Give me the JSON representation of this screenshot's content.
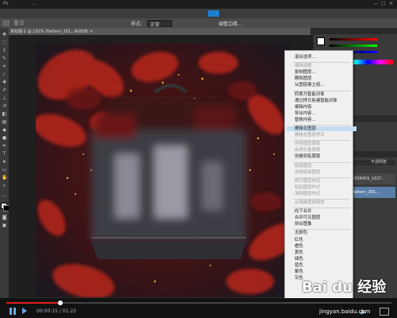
{
  "window": {
    "title": "…",
    "min": "—",
    "max": "□",
    "close": "✕"
  },
  "options_bar": {
    "mode_label": "样式:",
    "mode_value": "正常",
    "adjust": "调整边缘..."
  },
  "document_tab": {
    "label": "未标题-1 @ 102% (Pattern_201...RGB/8) ×"
  },
  "layers_panel": {
    "search_placeholder": "不透明度",
    "layer1": "5358459_1637...",
    "layer2": "Pattern_201...",
    "opacity_label": "不透明度:",
    "fill_label": "填充:"
  },
  "context_menu": {
    "items": [
      {
        "label": "混合选项...",
        "disabled": false
      },
      {
        "label": "编辑调整...",
        "disabled": true
      },
      {
        "label": "复制图层...",
        "disabled": false
      },
      {
        "label": "删除图层",
        "disabled": false
      },
      {
        "label": "从图层建立组...",
        "disabled": false
      },
      {
        "label": "转换为智能对象",
        "disabled": false
      },
      {
        "label": "通过拷贝新建智能对象",
        "disabled": false
      },
      {
        "label": "编辑内容",
        "disabled": false
      },
      {
        "label": "导出内容...",
        "disabled": false
      },
      {
        "label": "替换内容...",
        "disabled": false
      },
      {
        "label": "栅格化图层",
        "disabled": false,
        "highlight": true
      },
      {
        "label": "栅格化图层样式",
        "disabled": true
      },
      {
        "label": "停用图层蒙版",
        "disabled": true
      },
      {
        "label": "启用矢量蒙版",
        "disabled": true
      },
      {
        "label": "创建剪贴蒙版",
        "disabled": false
      },
      {
        "label": "链接图层",
        "disabled": true
      },
      {
        "label": "选择链接图层",
        "disabled": true
      },
      {
        "label": "拷贝图层样式",
        "disabled": true
      },
      {
        "label": "粘贴图层样式",
        "disabled": true
      },
      {
        "label": "清除图层样式",
        "disabled": true
      },
      {
        "label": "从隔离图层释放",
        "disabled": true
      },
      {
        "label": "向下合并",
        "disabled": false
      },
      {
        "label": "合并可见图层",
        "disabled": false
      },
      {
        "label": "拼合图像",
        "disabled": false
      },
      {
        "label": "无颜色",
        "disabled": false
      },
      {
        "label": "红色",
        "disabled": false
      },
      {
        "label": "橙色",
        "disabled": false
      },
      {
        "label": "黄色",
        "disabled": false
      },
      {
        "label": "绿色",
        "disabled": false
      },
      {
        "label": "蓝色",
        "disabled": false
      },
      {
        "label": "紫色",
        "disabled": false
      },
      {
        "label": "灰色",
        "disabled": false
      }
    ]
  },
  "video": {
    "time": "00:00:15 / 01:22",
    "progress": 0.14
  },
  "watermark": {
    "brand": "Bai du 经验",
    "url": "jingyan.baidu.com"
  }
}
